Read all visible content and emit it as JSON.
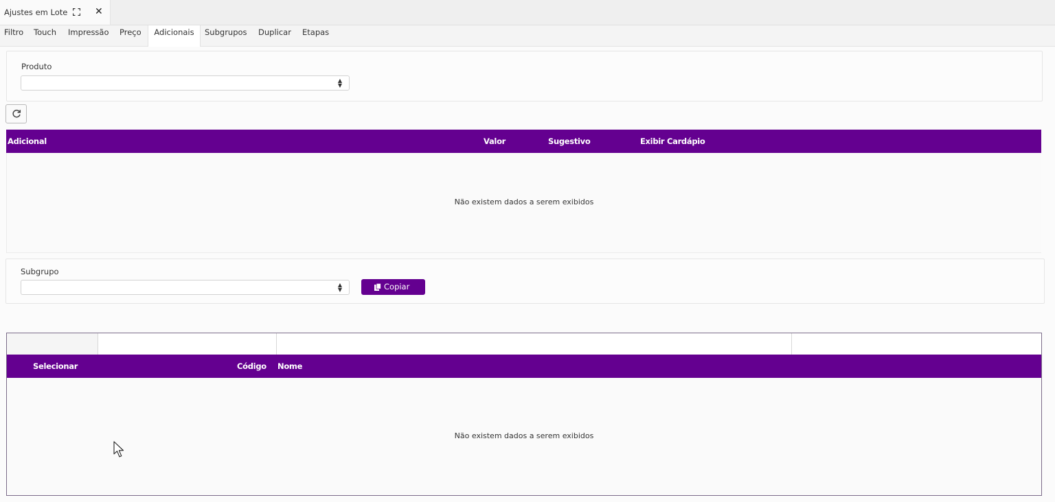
{
  "window": {
    "title": "Ajustes em Lote"
  },
  "tabs": [
    {
      "label": "Filtro",
      "active": false
    },
    {
      "label": "Touch",
      "active": false
    },
    {
      "label": "Impressão",
      "active": false
    },
    {
      "label": "Preço",
      "active": false
    },
    {
      "label": "Adicionais",
      "active": true
    },
    {
      "label": "Subgrupos",
      "active": false
    },
    {
      "label": "Duplicar",
      "active": false
    },
    {
      "label": "Etapas",
      "active": false
    }
  ],
  "produto": {
    "label": "Produto",
    "value": ""
  },
  "adicionais_grid": {
    "columns": [
      "Adicional",
      "Valor",
      "Sugestivo",
      "Exibir Cardápio"
    ],
    "empty_message": "Não existem dados a serem exibidos"
  },
  "subgrupo": {
    "label": "Subgrupo",
    "value": "",
    "copy_button": "Copiar"
  },
  "subgrupo_grid": {
    "columns": [
      "Selecionar",
      "Código",
      "Nome"
    ],
    "empty_message": "Não existem dados a serem exibidos"
  },
  "colors": {
    "accent": "#640090"
  }
}
